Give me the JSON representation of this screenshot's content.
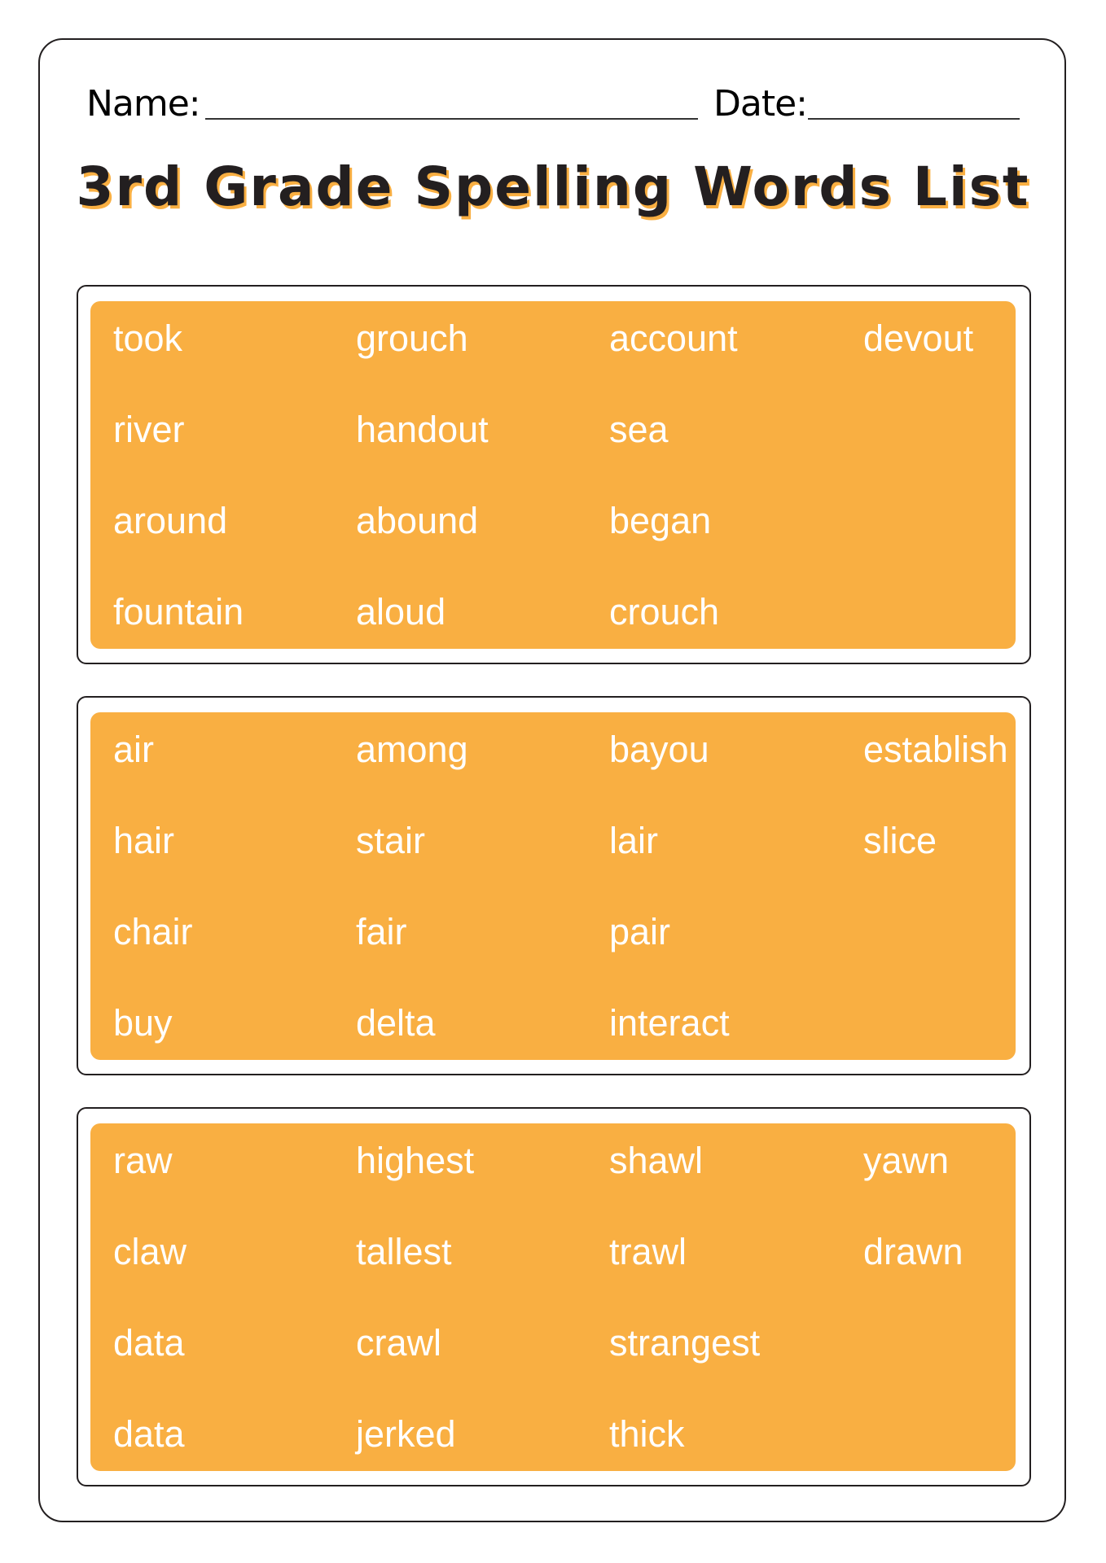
{
  "header": {
    "name_label": "Name:",
    "date_label": "Date:",
    "title": "3rd Grade Spelling Words List"
  },
  "colors": {
    "accent": "#F9AF42",
    "text_dark": "#231F20",
    "word_text": "#FFFFFF"
  },
  "word_groups": [
    {
      "rows": [
        [
          "took",
          "grouch",
          "account",
          "devout"
        ],
        [
          "river",
          "handout",
          "sea",
          ""
        ],
        [
          "around",
          "abound",
          "began",
          ""
        ],
        [
          "fountain",
          "aloud",
          "crouch",
          ""
        ]
      ]
    },
    {
      "rows": [
        [
          "air",
          "among",
          "bayou",
          "establish"
        ],
        [
          "hair",
          "stair",
          "lair",
          "slice"
        ],
        [
          "chair",
          "fair",
          "pair",
          ""
        ],
        [
          "buy",
          "delta",
          "interact",
          ""
        ]
      ]
    },
    {
      "rows": [
        [
          "raw",
          "highest",
          "shawl",
          "yawn"
        ],
        [
          "claw",
          "tallest",
          "trawl",
          "drawn"
        ],
        [
          "data",
          "crawl",
          "strangest",
          ""
        ],
        [
          "data",
          "jerked",
          "thick",
          ""
        ]
      ]
    }
  ]
}
